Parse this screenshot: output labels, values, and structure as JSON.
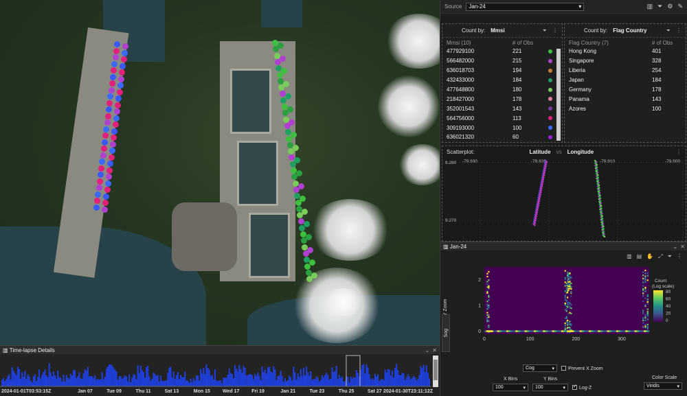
{
  "timelapse": {
    "title": "Time-lapse Details",
    "start": "2024-01-01T03:53:15Z",
    "end": "2024-01-30T23:11:12Z",
    "ticks": [
      "Jan 07",
      "Tue 09",
      "Thu 11",
      "Sat 13",
      "Mon 15",
      "Wed 17",
      "Fri 19",
      "Jan 21",
      "Tue 23",
      "Thu 25",
      "Sat 27"
    ],
    "bar_color": "#1f3fd8"
  },
  "source": {
    "label": "Source",
    "value": "Jan-24"
  },
  "count_mmsi": {
    "by_label": "Count by:",
    "field": "Mmsi",
    "col1": "Mmsi (10)",
    "col2": "# of Obs",
    "rows": [
      {
        "key": "477929100",
        "count": "221",
        "color": "#3fbf3f"
      },
      {
        "key": "566482000",
        "count": "215",
        "color": "#b040d0"
      },
      {
        "key": "636018703",
        "count": "194",
        "color": "#c87a3a"
      },
      {
        "key": "432433000",
        "count": "184",
        "color": "#20a060"
      },
      {
        "key": "477648800",
        "count": "180",
        "color": "#7acc5a"
      },
      {
        "key": "218427000",
        "count": "178",
        "color": "#e07aa0"
      },
      {
        "key": "352001543",
        "count": "143",
        "color": "#7a3a9a"
      },
      {
        "key": "564756000",
        "count": "113",
        "color": "#e0207a"
      },
      {
        "key": "309193000",
        "count": "100",
        "color": "#3a6aff"
      },
      {
        "key": "636021320",
        "count": "60",
        "color": "#9a20d0"
      }
    ]
  },
  "count_flag": {
    "by_label": "Count by:",
    "field": "Flag Country",
    "col1": "Flag Country (7)",
    "col2": "# of Obs",
    "rows": [
      {
        "key": "Hong Kong",
        "count": "401"
      },
      {
        "key": "Singapore",
        "count": "328"
      },
      {
        "key": "Liberia",
        "count": "254"
      },
      {
        "key": "Japan",
        "count": "184"
      },
      {
        "key": "Germany",
        "count": "178"
      },
      {
        "key": "Panama",
        "count": "143"
      },
      {
        "key": "Azores",
        "count": "100"
      }
    ]
  },
  "scatter": {
    "title": "Scatterplot:",
    "y_field": "Latitude",
    "vs": "vs",
    "x_field": "Longitude",
    "x_ticks": [
      "-79.930",
      "-79.920",
      "-79.910",
      "-79.900"
    ],
    "y_ticks": [
      "9.280",
      "9.270"
    ]
  },
  "heatmap": {
    "title": "Jan-24",
    "prevent_y": "Prevent Y Zoom",
    "prevent_x": "Prevent X Zoom",
    "y_tab": "Sog",
    "x_field": "Cog",
    "x_bins_label": "X Bins",
    "x_bins": "100",
    "y_bins_label": "Y Bins",
    "y_bins": "100",
    "log_z": "Log-Z",
    "color_scale_label": "Color Scale",
    "color_scale": "Viridis",
    "legend_title": "Count",
    "legend_sub": "(Log scale)",
    "legend_ticks": [
      "80",
      "60",
      "40",
      "20",
      "0"
    ]
  },
  "chart_data": {
    "type": "heatmap",
    "xlabel": "Cog",
    "ylabel": "Sog",
    "x_ticks": [
      0,
      100,
      200,
      300
    ],
    "y_ticks": [
      0,
      1,
      2
    ],
    "xlim": [
      0,
      360
    ],
    "ylim": [
      -0.1,
      2.5
    ],
    "colorscale": "Viridis",
    "zlim": [
      0,
      100
    ]
  }
}
